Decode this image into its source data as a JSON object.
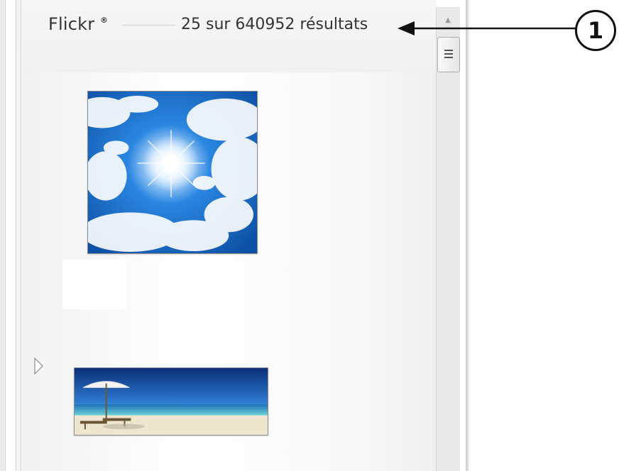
{
  "panel": {
    "provider_name": "Flickr",
    "provider_mark": "®",
    "result_count": "25 sur 640952 résultats"
  },
  "thumbnails": [
    {
      "subject": "sun-through-clouds-image"
    },
    {
      "subject": "beach-umbrella-image"
    }
  ],
  "callout": {
    "number": "1"
  },
  "colors": {
    "text": "#333333",
    "scroll_thumb_border": "#a9a9a9",
    "sky_blue": "#1f6fc9",
    "sea_teal": "#3fb6c9"
  }
}
